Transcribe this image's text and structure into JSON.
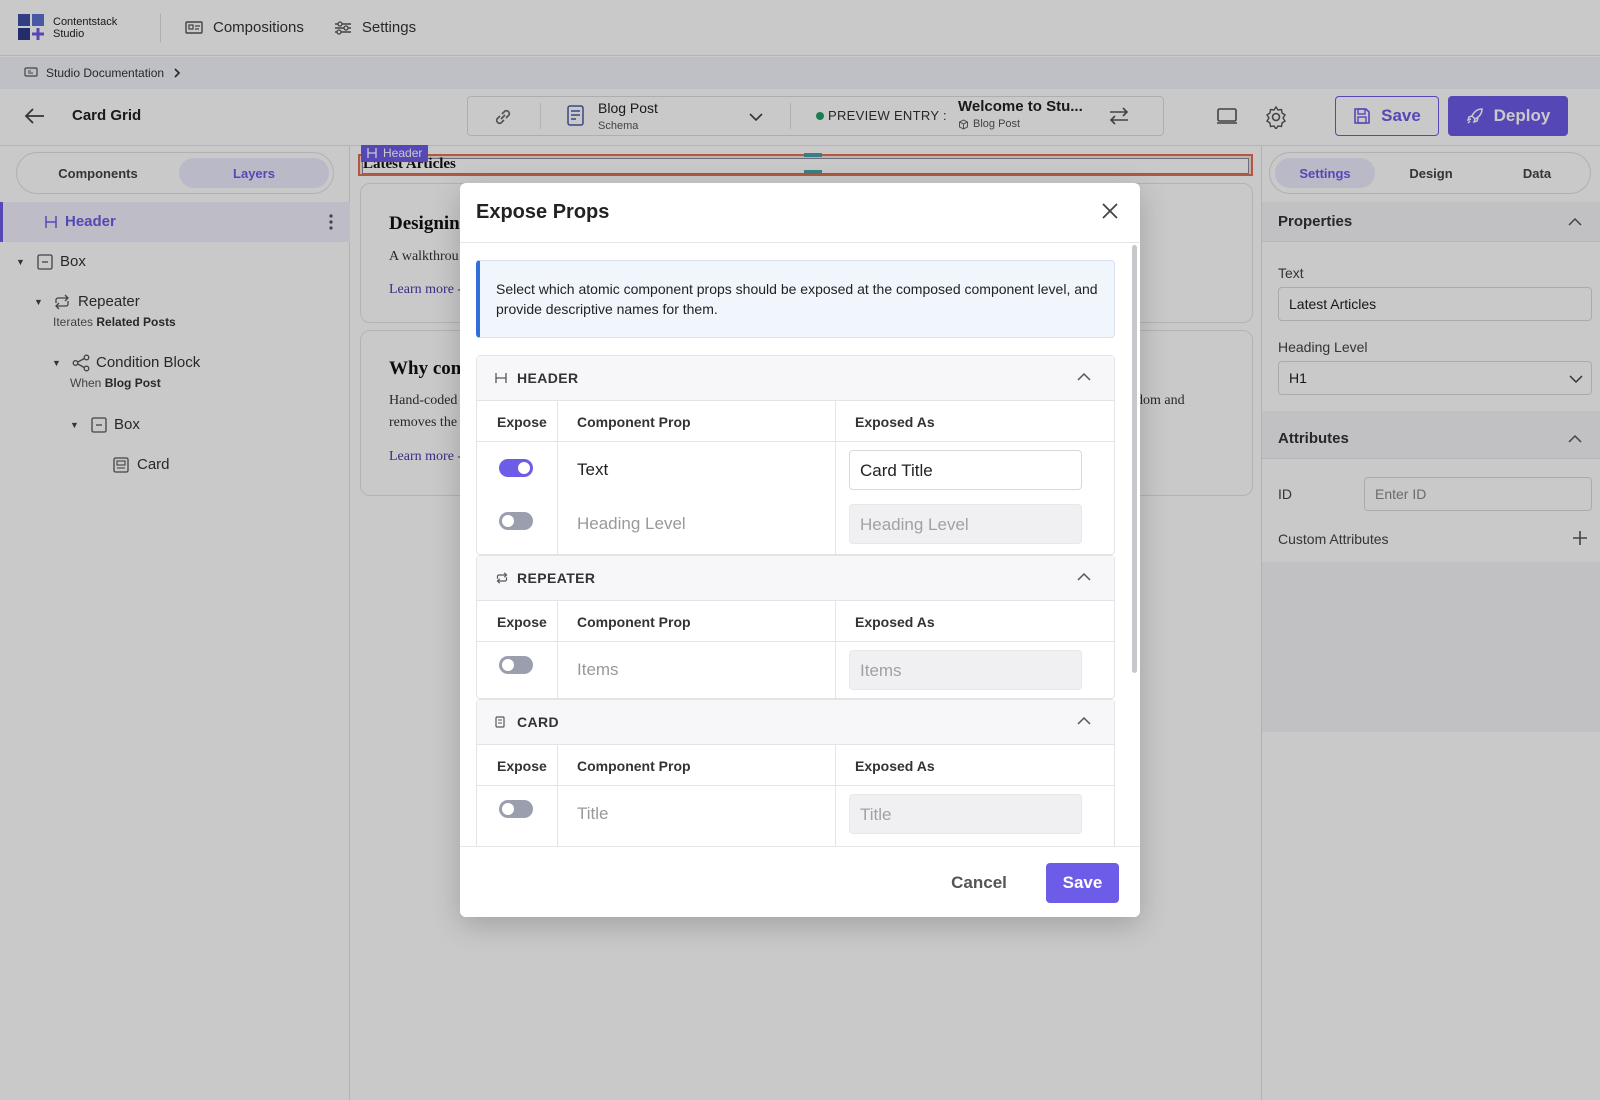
{
  "app": {
    "logo_line1": "Contentstack",
    "logo_line2": "Studio"
  },
  "nav": {
    "compositions": "Compositions",
    "settings": "Settings"
  },
  "breadcrumb": {
    "label": "Studio Documentation"
  },
  "toolbar": {
    "title": "Card Grid",
    "schema_name": "Blog Post",
    "schema_sub": "Schema",
    "preview_label": "PREVIEW ENTRY :",
    "entry_title": "Welcome to Stu...",
    "entry_type": "Blog Post",
    "save_label": "Save",
    "deploy_label": "Deploy"
  },
  "left": {
    "tab_components": "Components",
    "tab_layers": "Layers",
    "layers": {
      "header": "Header",
      "box1": "Box",
      "repeater": "Repeater",
      "repeater_sub_prefix": "Iterates",
      "repeater_sub_value": "Related Posts",
      "condition": "Condition Block",
      "condition_sub_prefix": "When",
      "condition_sub_value": "Blog Post",
      "box2": "Box",
      "card": "Card"
    }
  },
  "canvas": {
    "header_tag": "Header",
    "header_text": "Latest Articles",
    "card1_title": "Designin",
    "card1_body": "A walkthrou",
    "card1_link": "Learn more -",
    "card2_title": "Why con",
    "card2_body1": "Hand-coded",
    "card2_body2": "removes the",
    "card2_body_right": "dom and",
    "card2_link": "Learn more -"
  },
  "right": {
    "tab_settings": "Settings",
    "tab_design": "Design",
    "tab_data": "Data",
    "properties": "Properties",
    "text_label": "Text",
    "text_value": "Latest Articles",
    "heading_label": "Heading Level",
    "heading_value": "H1",
    "attributes": "Attributes",
    "id_label": "ID",
    "id_placeholder": "Enter ID",
    "custom_attributes": "Custom Attributes"
  },
  "modal": {
    "title": "Expose Props",
    "info": "Select which atomic component props should be exposed at the composed component level, and provide descriptive names for them.",
    "col_expose": "Expose",
    "col_prop": "Component Prop",
    "col_exposed_as": "Exposed As",
    "groups": [
      {
        "name": "HEADER",
        "rows": [
          {
            "prop": "Text",
            "exposed": true,
            "value": "Card Title"
          },
          {
            "prop": "Heading Level",
            "exposed": false,
            "placeholder": "Heading Level"
          }
        ]
      },
      {
        "name": "REPEATER",
        "rows": [
          {
            "prop": "Items",
            "exposed": false,
            "placeholder": "Items"
          }
        ]
      },
      {
        "name": "CARD",
        "rows": [
          {
            "prop": "Title",
            "exposed": false,
            "placeholder": "Title"
          }
        ]
      }
    ],
    "cancel": "Cancel",
    "save": "Save"
  },
  "colors": {
    "accent": "#6c5ce7",
    "info_border": "#2f6fd6",
    "selection": "#e17055"
  }
}
